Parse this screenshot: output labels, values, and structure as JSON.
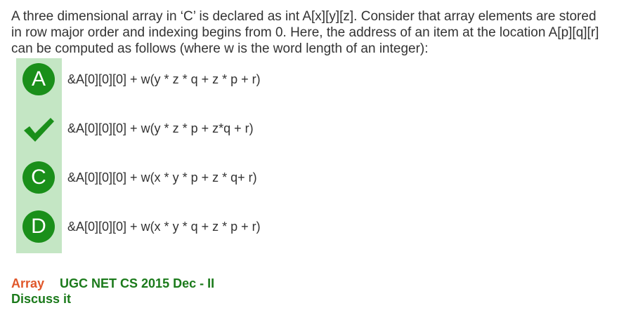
{
  "question": {
    "text": "A three dimensional array in ‘C’ is declared as int A[x][y][z]. Consider that array elements are stored in row major order and indexing begins from 0. Here, the address of an item at the location A[p][q][r] can be computed as follows (where w is the word length of an integer):"
  },
  "options": [
    {
      "badge": "A",
      "icon": "letter-badge",
      "text": "&A[0][0][0] + w(y * z * q + z * p + r)"
    },
    {
      "badge": "",
      "icon": "checkmark-icon",
      "text": "&A[0][0][0] + w(y * z * p + z*q + r)"
    },
    {
      "badge": "C",
      "icon": "letter-badge",
      "text": "&A[0][0][0] + w(x * y * p + z * q+ r)"
    },
    {
      "badge": "D",
      "icon": "letter-badge",
      "text": "&A[0][0][0] + w(x * y * q + z * p + r)"
    }
  ],
  "footer": {
    "topic": "Array",
    "exam": "UGC NET CS 2015 Dec - II",
    "discuss": "Discuss it"
  },
  "colors": {
    "badge": "#1a8f1a",
    "strip": "#c4e6c4",
    "topic": "#e0572a",
    "link": "#1b7a1b"
  }
}
